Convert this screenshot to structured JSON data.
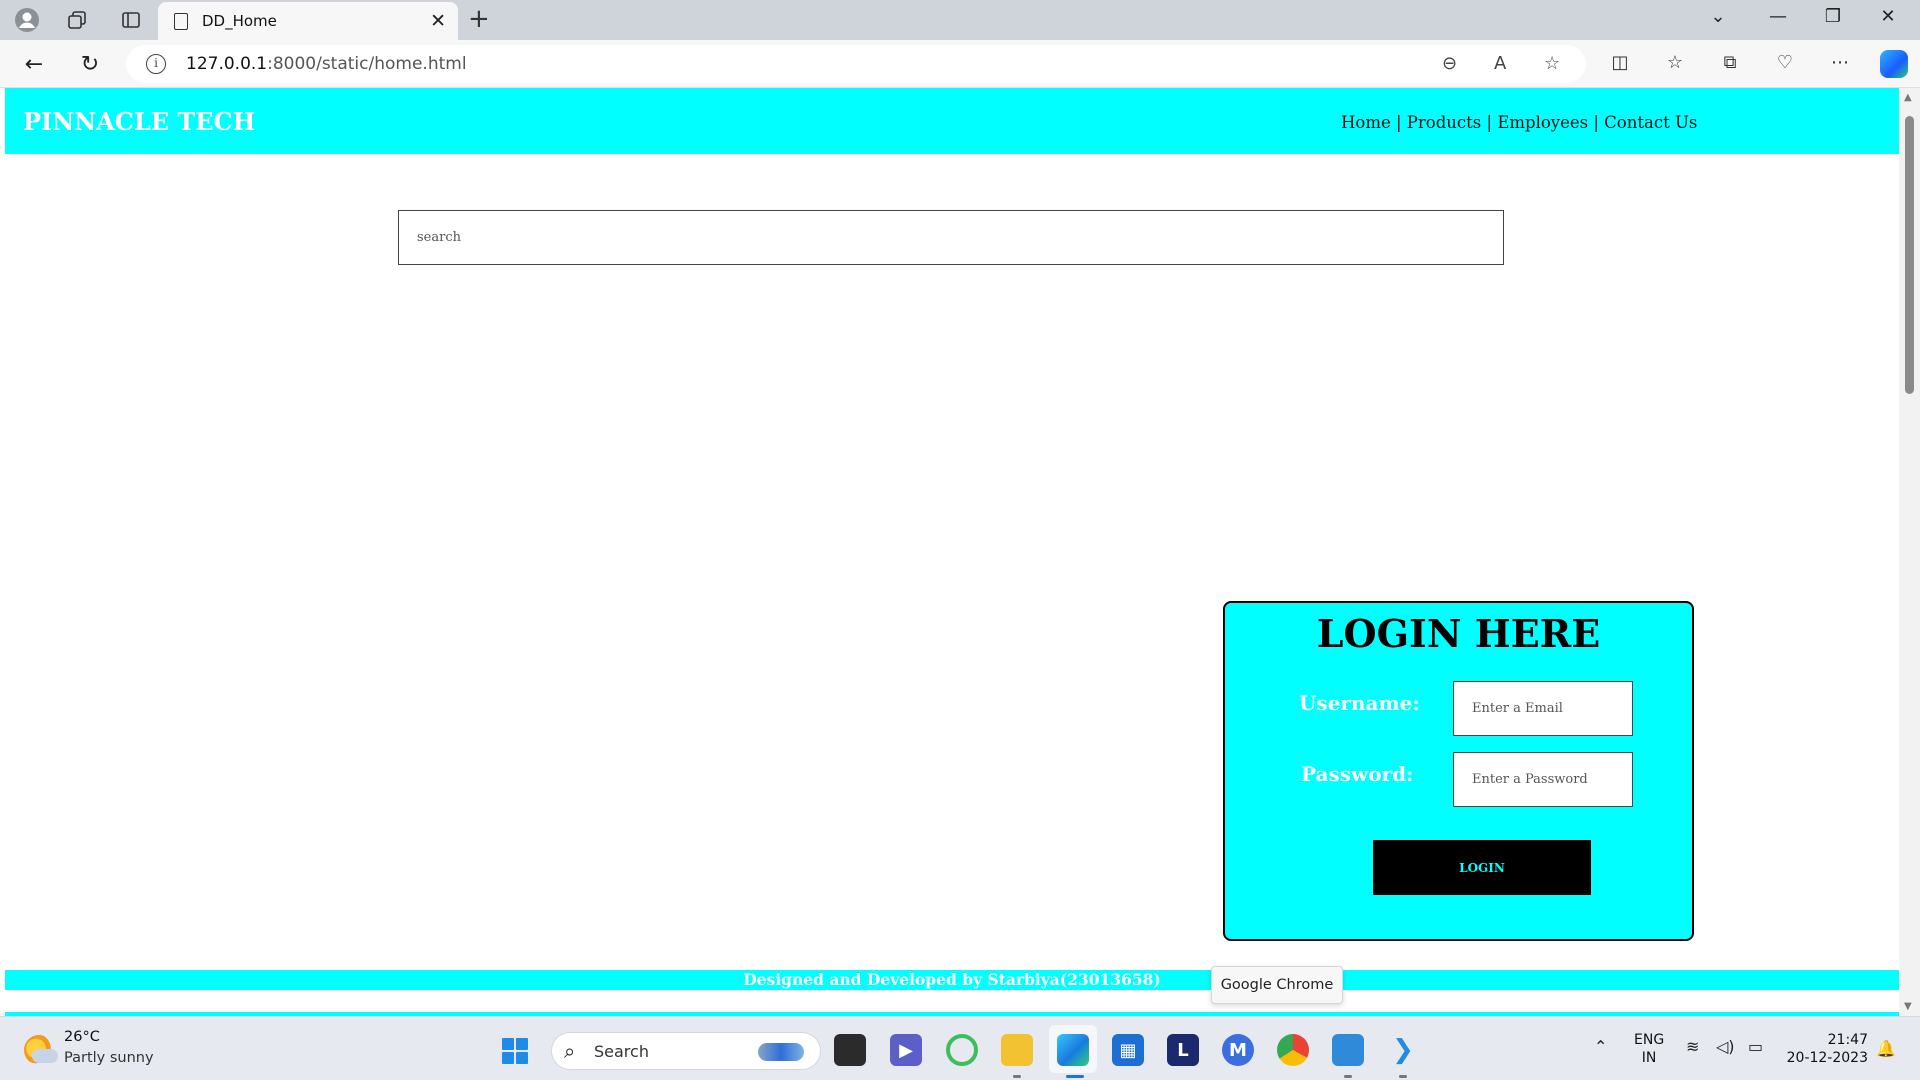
{
  "browser": {
    "tab_title": "DD_Home",
    "url_host": "127.0.0.1",
    "url_path": ":8000/static/home.html",
    "tooltip": "Google Chrome"
  },
  "site": {
    "brand": "PINNACLE TECH",
    "nav": [
      {
        "label": "Home"
      },
      {
        "label": "Products"
      },
      {
        "label": "Employees"
      },
      {
        "label": "Contact Us"
      }
    ],
    "nav_separator": " | ",
    "search": {
      "placeholder": "search",
      "value": ""
    },
    "login": {
      "title": "LOGIN HERE",
      "username_label": "Username:",
      "username_placeholder": "Enter a Email",
      "password_label": "Password:",
      "password_placeholder": "Enter a Password",
      "button_label": "LOGIN"
    },
    "footer": "Designed and Developed by Starbiya(23013658)",
    "colors": {
      "accent": "#00ffff",
      "button_bg": "#000000",
      "text_light": "#ffffff"
    }
  },
  "taskbar": {
    "weather_temp": "26°C",
    "weather_desc": "Partly sunny",
    "search_label": "Search",
    "lang_top": "ENG",
    "lang_bottom": "IN",
    "time": "21:47",
    "date": "20-12-2023"
  }
}
